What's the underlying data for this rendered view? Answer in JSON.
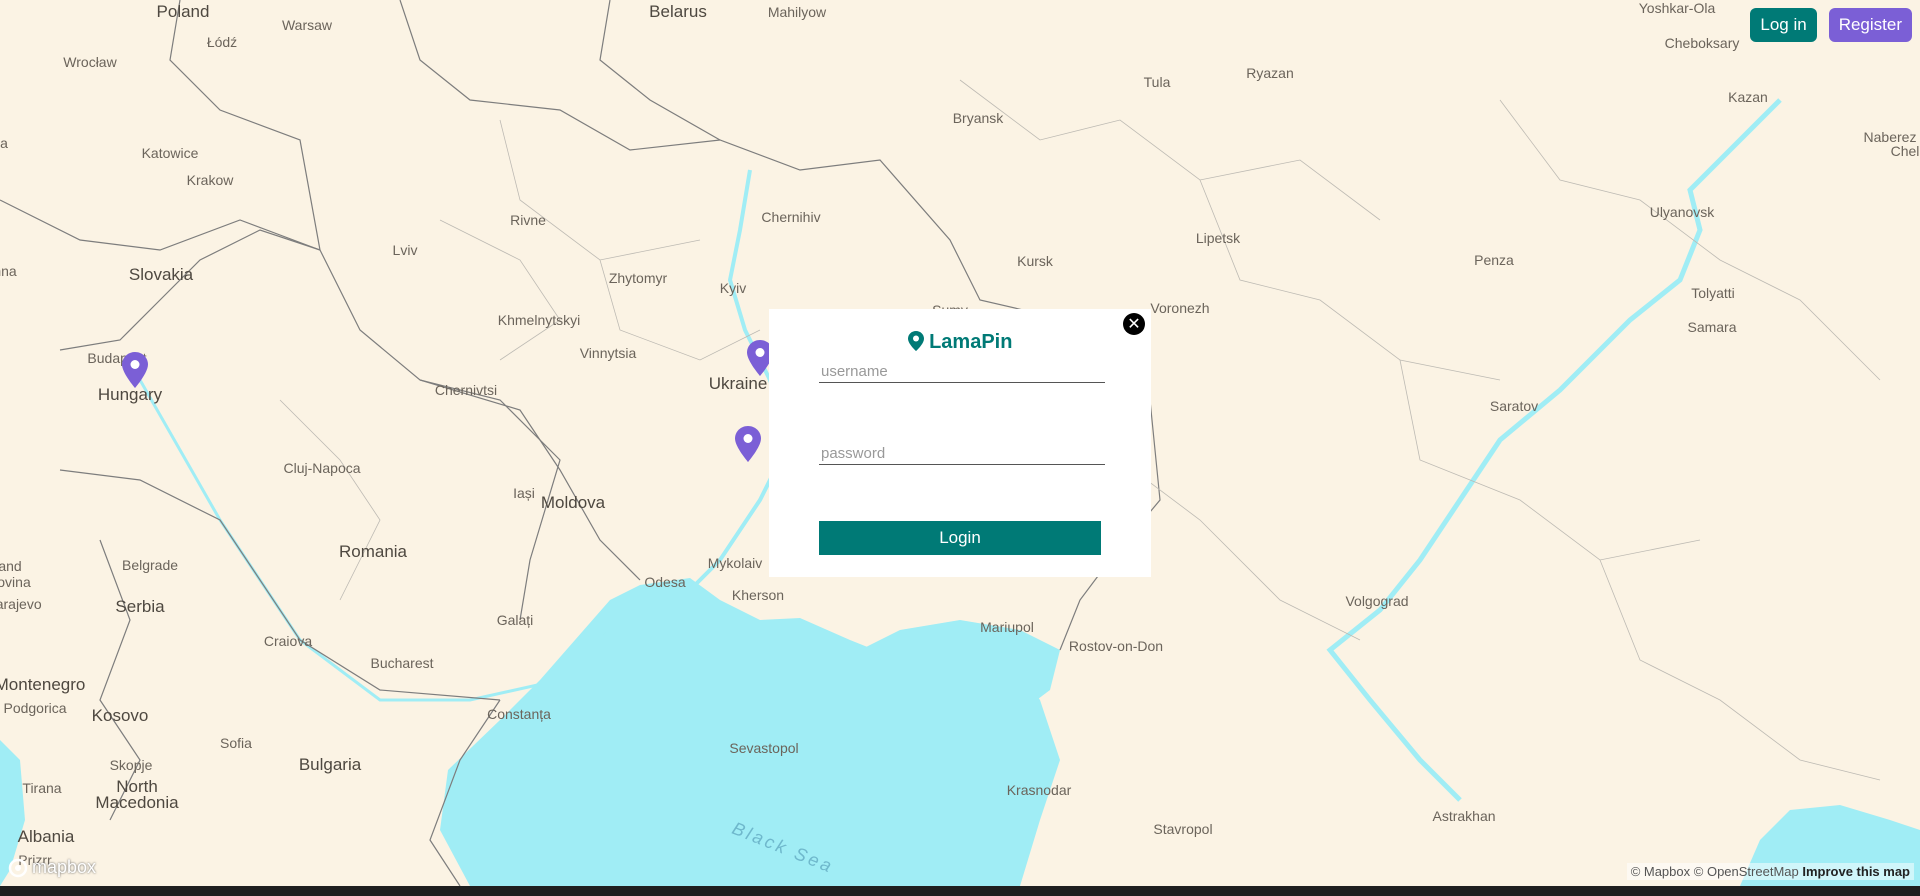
{
  "app": {
    "name": "LamaPin"
  },
  "header": {
    "login_label": "Log in",
    "register_label": "Register"
  },
  "colors": {
    "brand": "#007a76",
    "accent": "#7b5fd6",
    "water": "#a0edf5",
    "land": "#fbf3e4"
  },
  "map": {
    "labels": [
      {
        "text": "Poland",
        "kind": "country"
      },
      {
        "text": "Warsaw",
        "kind": "city"
      },
      {
        "text": "Belarus",
        "kind": "country"
      },
      {
        "text": "Mahilyow",
        "kind": "city"
      },
      {
        "text": "Łódź",
        "kind": "city"
      },
      {
        "text": "Wrocław",
        "kind": "city"
      },
      {
        "text": "Katowice",
        "kind": "city"
      },
      {
        "text": "Krakow",
        "kind": "city"
      },
      {
        "text": "Slovakia",
        "kind": "country"
      },
      {
        "text": "Budapest",
        "kind": "city"
      },
      {
        "text": "Hungary",
        "kind": "country"
      },
      {
        "text": "Lviv",
        "kind": "city"
      },
      {
        "text": "Rivne",
        "kind": "city"
      },
      {
        "text": "Zhytomyr",
        "kind": "city"
      },
      {
        "text": "Chernihiv",
        "kind": "city"
      },
      {
        "text": "Kyiv",
        "kind": "city"
      },
      {
        "text": "Khmelnytskyi",
        "kind": "city"
      },
      {
        "text": "Vinnytsia",
        "kind": "city"
      },
      {
        "text": "Chernivtsi",
        "kind": "city"
      },
      {
        "text": "Ukraine",
        "kind": "country"
      },
      {
        "text": "Cluj-Napoca",
        "kind": "city"
      },
      {
        "text": "Iași",
        "kind": "city"
      },
      {
        "text": "Moldova",
        "kind": "country"
      },
      {
        "text": "Romania",
        "kind": "country"
      },
      {
        "text": "Belgrade",
        "kind": "city"
      },
      {
        "text": "Serbia",
        "kind": "country"
      },
      {
        "text": "Craiova",
        "kind": "city"
      },
      {
        "text": "Bucharest",
        "kind": "city"
      },
      {
        "text": "Galați",
        "kind": "city"
      },
      {
        "text": "Odesa",
        "kind": "city"
      },
      {
        "text": "Mykolaiv",
        "kind": "city"
      },
      {
        "text": "Kherson",
        "kind": "city"
      },
      {
        "text": "Constanța",
        "kind": "city"
      },
      {
        "text": "Montenegro",
        "kind": "country"
      },
      {
        "text": "Podgorica",
        "kind": "city"
      },
      {
        "text": "Kosovo",
        "kind": "country"
      },
      {
        "text": "Sofia",
        "kind": "city"
      },
      {
        "text": "Bulgaria",
        "kind": "country"
      },
      {
        "text": "Skopje",
        "kind": "city"
      },
      {
        "text": "North",
        "kind": "country"
      },
      {
        "text": "Macedonia",
        "kind": "country"
      },
      {
        "text": "Tirana",
        "kind": "city"
      },
      {
        "text": "Albania",
        "kind": "country"
      },
      {
        "text": "Sevastopol",
        "kind": "city"
      },
      {
        "text": "Mariupol",
        "kind": "city"
      },
      {
        "text": "Rostov-on-Don",
        "kind": "city"
      },
      {
        "text": "Krasnodar",
        "kind": "city"
      },
      {
        "text": "Stavropol",
        "kind": "city"
      },
      {
        "text": "Black Sea",
        "kind": "sea"
      },
      {
        "text": "Bryansk",
        "kind": "city"
      },
      {
        "text": "Tula",
        "kind": "city"
      },
      {
        "text": "Ryazan",
        "kind": "city"
      },
      {
        "text": "Kursk",
        "kind": "city"
      },
      {
        "text": "Lipetsk",
        "kind": "city"
      },
      {
        "text": "Voronezh",
        "kind": "city"
      },
      {
        "text": "Penza",
        "kind": "city"
      },
      {
        "text": "Saratov",
        "kind": "city"
      },
      {
        "text": "Volgograd",
        "kind": "city"
      },
      {
        "text": "Astrakhan",
        "kind": "city"
      },
      {
        "text": "Ulyanovsk",
        "kind": "city"
      },
      {
        "text": "Tolyatti",
        "kind": "city"
      },
      {
        "text": "Samara",
        "kind": "city"
      },
      {
        "text": "Kazan",
        "kind": "city"
      },
      {
        "text": "Cheboksary",
        "kind": "city"
      },
      {
        "text": "Yoshkar-Ola",
        "kind": "city"
      },
      {
        "text": "Naberez",
        "kind": "city"
      },
      {
        "text": "Chel",
        "kind": "city"
      },
      {
        "text": "Sumy",
        "kind": "city"
      },
      {
        "text": "Sarajevo",
        "kind": "city"
      },
      {
        "text": "and",
        "kind": "city"
      },
      {
        "text": "ovina",
        "kind": "city"
      },
      {
        "text": "nna",
        "kind": "city"
      },
      {
        "text": "a",
        "kind": "city"
      },
      {
        "text": "Prizrr",
        "kind": "city"
      }
    ],
    "pins": [
      {
        "name": "pin-budapest"
      },
      {
        "name": "pin-kyiv"
      },
      {
        "name": "pin-central-ukraine"
      }
    ]
  },
  "login_modal": {
    "title": "LamaPin",
    "username_placeholder": "username",
    "password_placeholder": "password",
    "submit_label": "Login",
    "close_symbol": "✕"
  },
  "attribution": {
    "mapbox": "© Mapbox",
    "osm": "© OpenStreetMap",
    "improve": "Improve this map",
    "logo": "mapbox"
  }
}
